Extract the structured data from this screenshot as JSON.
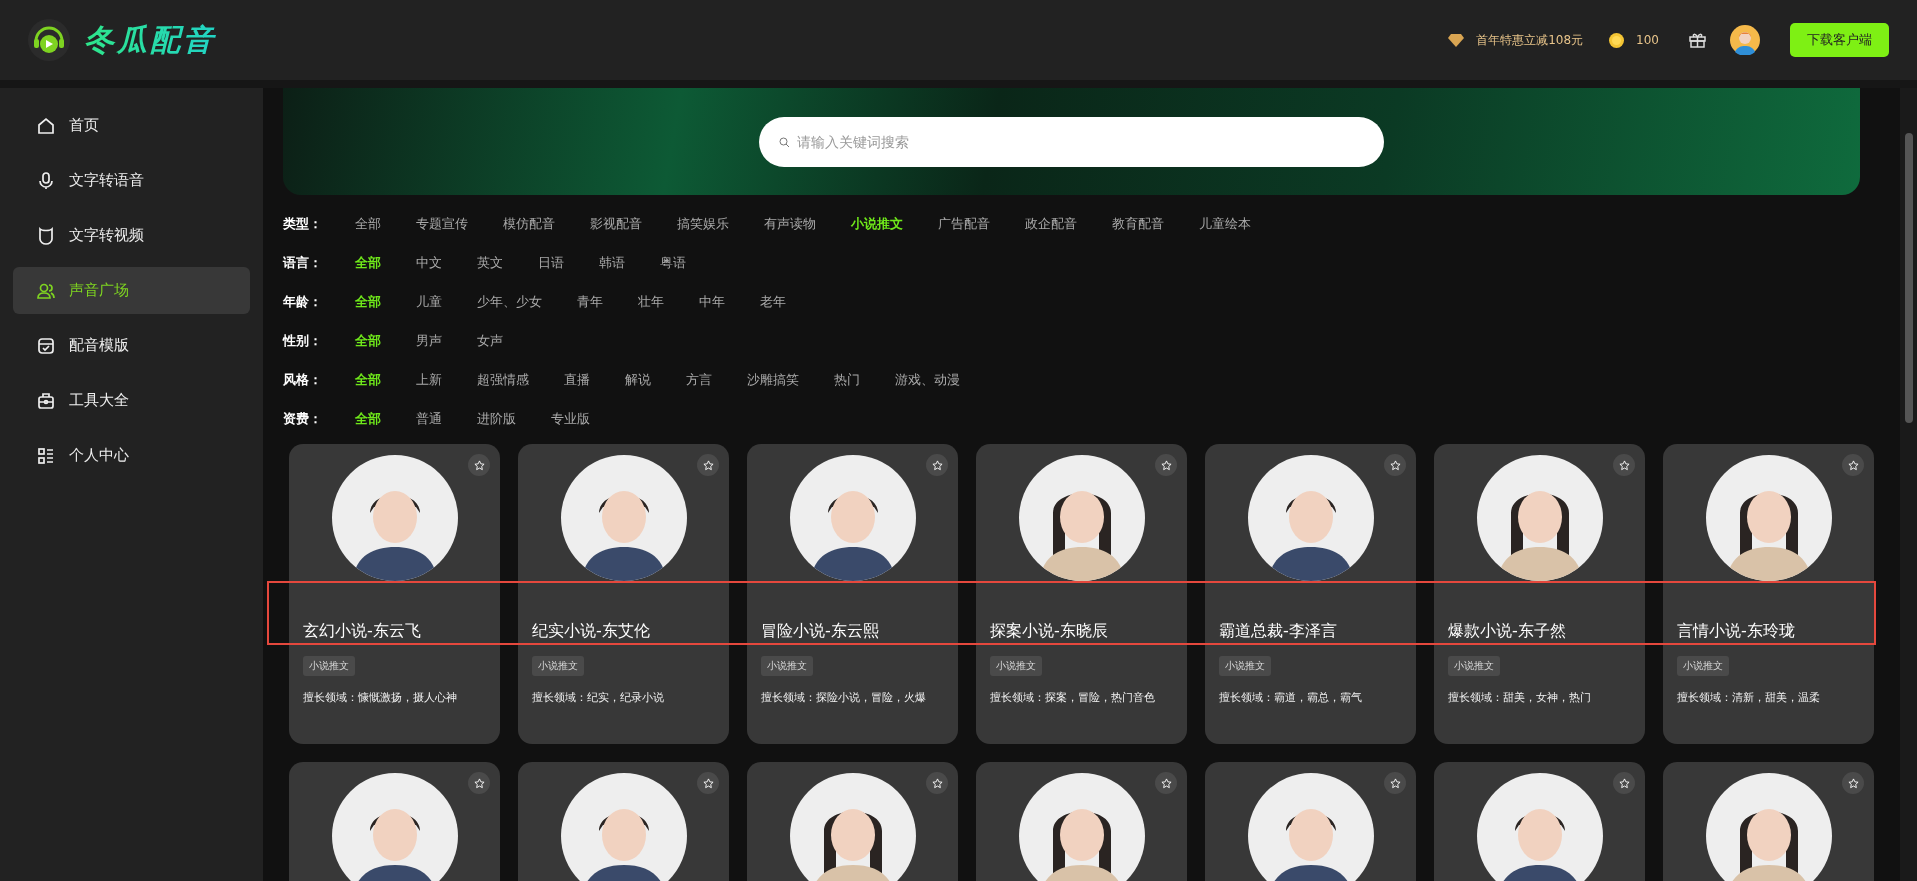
{
  "header": {
    "app_name": "冬瓜配音",
    "promo": "首年特惠立减108元",
    "coins": "100",
    "download_button": "下载客户端"
  },
  "sidebar": {
    "items": [
      {
        "label": "首页",
        "selected": false
      },
      {
        "label": "文字转语音",
        "selected": false
      },
      {
        "label": "文字转视频",
        "selected": false
      },
      {
        "label": "声音广场",
        "selected": true
      },
      {
        "label": "配音模版",
        "selected": false
      },
      {
        "label": "工具大全",
        "selected": false
      },
      {
        "label": "个人中心",
        "selected": false
      }
    ]
  },
  "search": {
    "placeholder": "请输入关键词搜索"
  },
  "filters": [
    {
      "label": "类型：",
      "options": [
        {
          "label": "全部",
          "selected": false
        },
        {
          "label": "专题宣传",
          "selected": false
        },
        {
          "label": "模仿配音",
          "selected": false
        },
        {
          "label": "影视配音",
          "selected": false
        },
        {
          "label": "搞笑娱乐",
          "selected": false
        },
        {
          "label": "有声读物",
          "selected": false
        },
        {
          "label": "小说推文",
          "selected": true
        },
        {
          "label": "广告配音",
          "selected": false
        },
        {
          "label": "政企配音",
          "selected": false
        },
        {
          "label": "教育配音",
          "selected": false
        },
        {
          "label": "儿童绘本",
          "selected": false
        }
      ]
    },
    {
      "label": "语言：",
      "options": [
        {
          "label": "全部",
          "selected": true
        },
        {
          "label": "中文",
          "selected": false
        },
        {
          "label": "英文",
          "selected": false
        },
        {
          "label": "日语",
          "selected": false
        },
        {
          "label": "韩语",
          "selected": false
        },
        {
          "label": "粤语",
          "selected": false
        }
      ]
    },
    {
      "label": "年龄：",
      "options": [
        {
          "label": "全部",
          "selected": true
        },
        {
          "label": "儿童",
          "selected": false
        },
        {
          "label": "少年、少女",
          "selected": false
        },
        {
          "label": "青年",
          "selected": false
        },
        {
          "label": "壮年",
          "selected": false
        },
        {
          "label": "中年",
          "selected": false
        },
        {
          "label": "老年",
          "selected": false
        }
      ]
    },
    {
      "label": "性别：",
      "options": [
        {
          "label": "全部",
          "selected": true
        },
        {
          "label": "男声",
          "selected": false
        },
        {
          "label": "女声",
          "selected": false
        }
      ]
    },
    {
      "label": "风格：",
      "options": [
        {
          "label": "全部",
          "selected": true
        },
        {
          "label": "上新",
          "selected": false
        },
        {
          "label": "超强情感",
          "selected": false
        },
        {
          "label": "直播",
          "selected": false
        },
        {
          "label": "解说",
          "selected": false
        },
        {
          "label": "方言",
          "selected": false
        },
        {
          "label": "沙雕搞笑",
          "selected": false
        },
        {
          "label": "热门",
          "selected": false
        },
        {
          "label": "游戏、动漫",
          "selected": false
        }
      ]
    },
    {
      "label": "资费：",
      "options": [
        {
          "label": "全部",
          "selected": true
        },
        {
          "label": "普通",
          "selected": false
        },
        {
          "label": "进阶版",
          "selected": false
        },
        {
          "label": "专业版",
          "selected": false
        }
      ]
    }
  ],
  "annotation": {
    "kind": "frame"
  },
  "voices": [
    {
      "avatar": {
        "kind": "picture"
      },
      "name": "玄幻小说-东云飞",
      "tag": "小说推文",
      "skills": "擅长领域：慷慨激扬，摄人心神"
    },
    {
      "avatar": {
        "kind": "picture"
      },
      "name": "纪实小说-东艾伦",
      "tag": "小说推文",
      "skills": "擅长领域：纪实，纪录小说"
    },
    {
      "avatar": {
        "kind": "picture"
      },
      "name": "冒险小说-东云熙",
      "tag": "小说推文",
      "skills": "擅长领域：探险小说，冒险，火爆"
    },
    {
      "avatar": {
        "kind": "picture"
      },
      "name": "探案小说-东晓辰",
      "tag": "小说推文",
      "skills": "擅长领域：探案，冒险，热门音色"
    },
    {
      "avatar": {
        "kind": "picture"
      },
      "name": "霸道总裁-李泽言",
      "tag": "小说推文",
      "skills": "擅长领域：霸道，霸总，霸气"
    },
    {
      "avatar": {
        "kind": "picture"
      },
      "name": "爆款小说-东子然",
      "tag": "小说推文",
      "skills": "擅长领域：甜美，女神，热门"
    },
    {
      "avatar": {
        "kind": "picture"
      },
      "name": "言情小说-东玲珑",
      "tag": "小说推文",
      "skills": "擅长领域：清新，甜美，温柔"
    },
    {
      "avatar": {
        "kind": "picture"
      }
    },
    {
      "avatar": {
        "kind": "picture"
      }
    },
    {
      "avatar": {
        "kind": "picture"
      }
    },
    {
      "avatar": {
        "kind": "picture"
      }
    },
    {
      "avatar": {
        "kind": "picture"
      }
    },
    {
      "avatar": {
        "kind": "picture"
      }
    },
    {
      "avatar": {
        "kind": "picture"
      }
    }
  ]
}
